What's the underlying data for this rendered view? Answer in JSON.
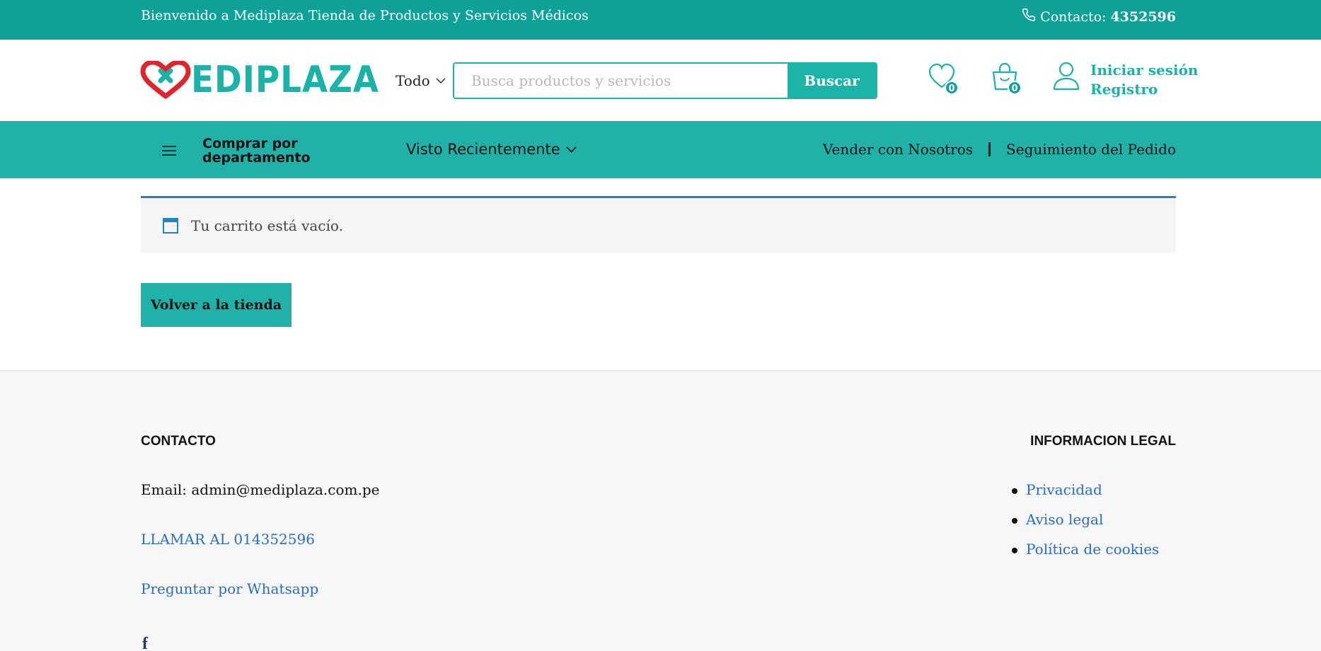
{
  "topbar": {
    "welcome": "Bienvenido a Mediplaza Tienda de Productos y Servicios Médicos",
    "contact_label": "Contacto: ",
    "contact_number": "4352596",
    "phone_icon": "phone-icon"
  },
  "header": {
    "logo_text": "EDIPLAZA",
    "category_label": "Todo",
    "search_placeholder": "Busca productos y servicios",
    "search_button": "Buscar",
    "wishlist_count": "0",
    "cart_count": "0",
    "login_label": "Iniciar sesión",
    "register_label": "Registro"
  },
  "nav": {
    "department_label": "Comprar por departamento",
    "recent_label": "Visto Recientemente",
    "sell_label": "Vender con Nosotros",
    "tracking_label": "Seguimiento del Pedido"
  },
  "main": {
    "empty_cart_message": "Tu carrito está vacío.",
    "back_button": "Volver a la tienda"
  },
  "footer": {
    "contact_title": "CONTACTO",
    "email_text": "Email: admin@mediplaza.com.pe",
    "call_link": "LLAMAR AL 014352596",
    "whatsapp_link": "Preguntar por Whatsapp",
    "legal_title": "INFORMACION LEGAL",
    "legal_links": [
      "Privacidad",
      "Aviso legal",
      "Política de cookies"
    ],
    "facebook_icon": "f"
  },
  "colors": {
    "brand_dark": "#0fa197",
    "brand": "#20b2a9",
    "logo_red": "#e0242c",
    "link_blue": "#2b6cc4",
    "notice_border": "#1e85be"
  }
}
